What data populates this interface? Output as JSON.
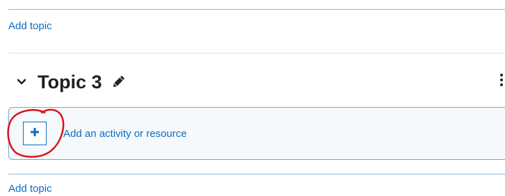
{
  "top_add_topic": {
    "label": "Add topic"
  },
  "section": {
    "title": "Topic 3",
    "collapse_icon": "chevron-down-icon",
    "edit_icon": "pencil-icon",
    "menu_icon": "kebab-menu-icon"
  },
  "activity_chooser": {
    "button_icon": "plus-icon",
    "label": "Add an activity or resource"
  },
  "bottom_add_topic": {
    "label": "Add topic"
  },
  "colors": {
    "link": "#0f6cbf",
    "annotation": "#d9121b",
    "box_background": "#f5f9fc"
  }
}
